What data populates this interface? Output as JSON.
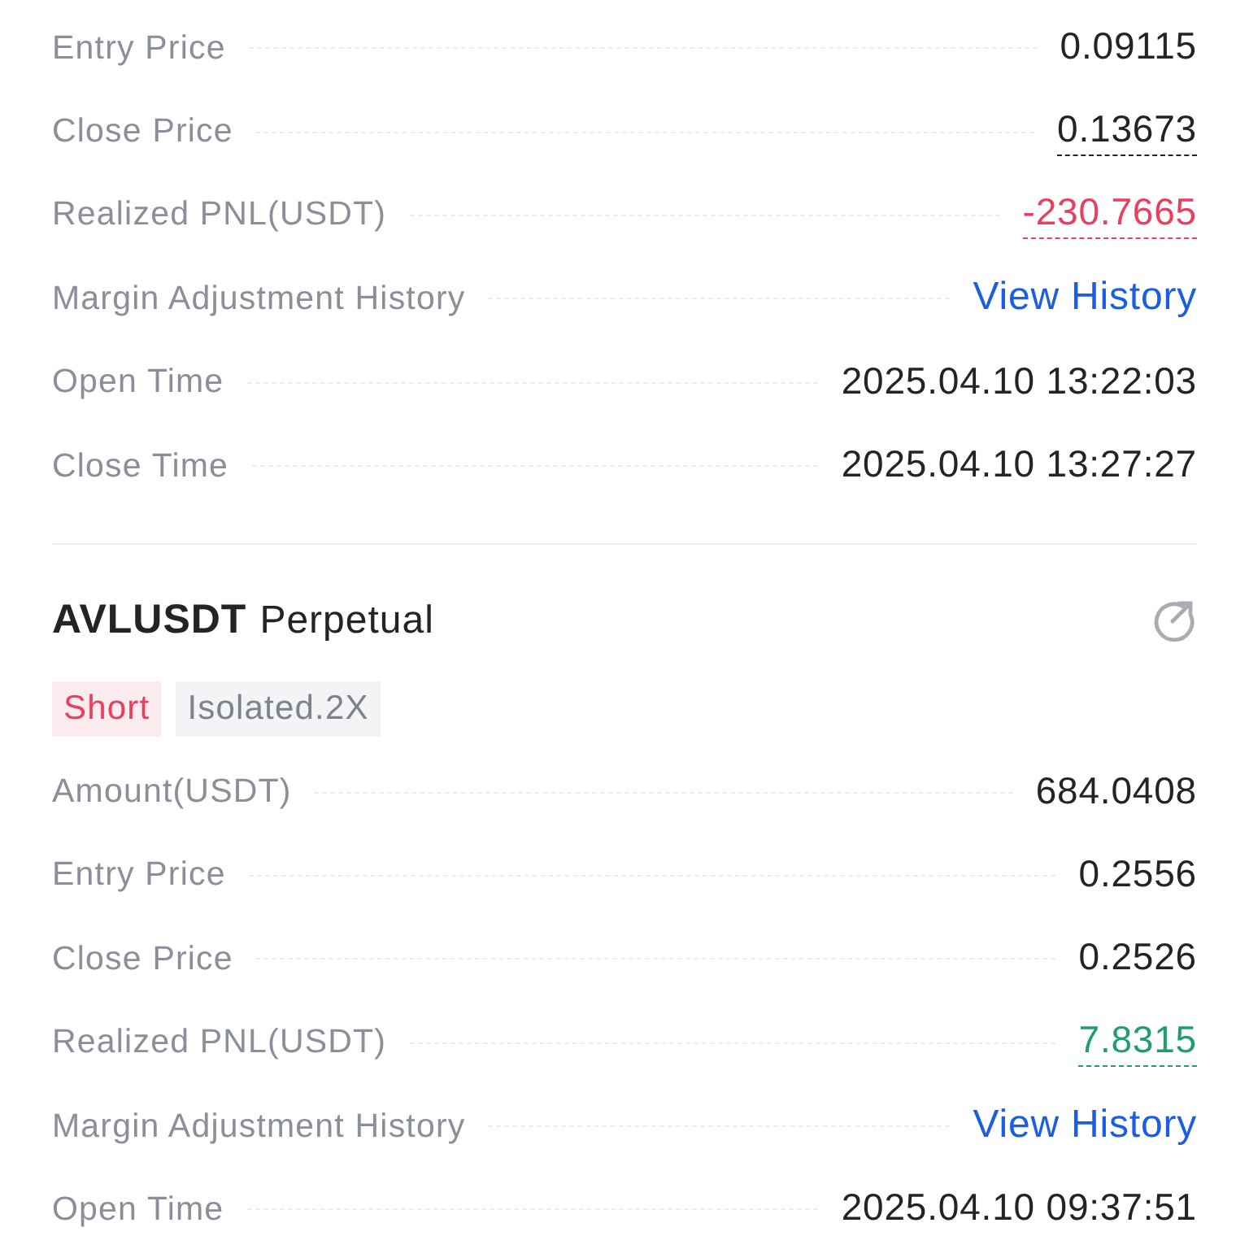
{
  "positions": [
    {
      "rows": [
        {
          "label": "Entry Price",
          "value": "0.09115",
          "kind": "plain"
        },
        {
          "label": "Close Price",
          "value": "0.13673",
          "kind": "underlined"
        },
        {
          "label": "Realized PNL(USDT)",
          "value": "-230.7665",
          "kind": "loss"
        },
        {
          "label": "Margin Adjustment History",
          "value": "View History",
          "kind": "link"
        },
        {
          "label": "Open Time",
          "value": "2025.04.10 13:22:03",
          "kind": "plain"
        },
        {
          "label": "Close Time",
          "value": "2025.04.10 13:27:27",
          "kind": "plain"
        }
      ]
    },
    {
      "header": {
        "symbol": "AVLUSDT",
        "type": "Perpetual"
      },
      "tags": [
        {
          "label": "Short",
          "kind": "side"
        },
        {
          "label": "Isolated.2X",
          "kind": "margin"
        }
      ],
      "rows": [
        {
          "label": "Amount(USDT)",
          "value": "684.0408",
          "kind": "plain"
        },
        {
          "label": "Entry Price",
          "value": "0.2556",
          "kind": "plain"
        },
        {
          "label": "Close Price",
          "value": "0.2526",
          "kind": "plain"
        },
        {
          "label": "Realized PNL(USDT)",
          "value": "7.8315",
          "kind": "profit"
        },
        {
          "label": "Margin Adjustment History",
          "value": "View History",
          "kind": "link"
        },
        {
          "label": "Open Time",
          "value": "2025.04.10 09:37:51",
          "kind": "plain"
        }
      ]
    }
  ]
}
